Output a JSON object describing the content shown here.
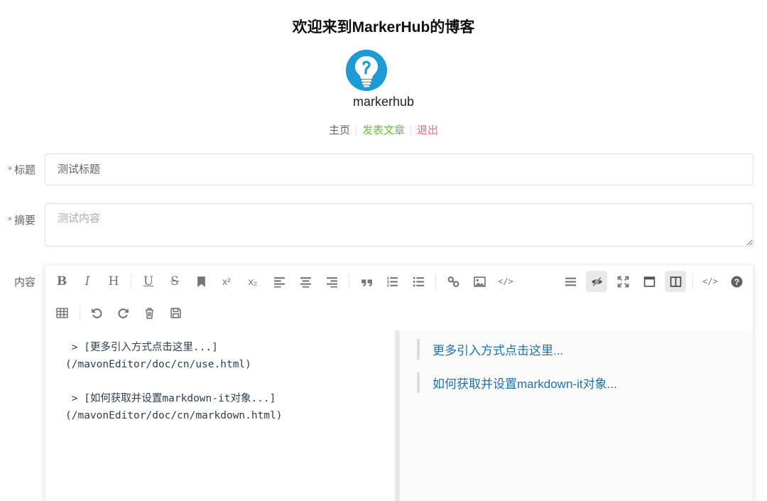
{
  "site": {
    "title": "欢迎来到MarkerHub的博客",
    "username": "markerhub"
  },
  "nav": {
    "home": "主页",
    "post": "发表文章",
    "logout": "退出"
  },
  "form": {
    "title_label": "标题",
    "title_value": "测试标题",
    "summary_label": "摘要",
    "summary_placeholder": "测试内容",
    "content_label": "内容",
    "required_mark": "*"
  },
  "toolbar": {
    "row1_left": [
      "bold",
      "italic",
      "header",
      "underline",
      "strikethrough",
      "mark",
      "superscript",
      "subscript",
      "align-left",
      "align-center",
      "align-right",
      "quote",
      "ordered-list",
      "unordered-list",
      "link",
      "image",
      "code"
    ],
    "row1_right": [
      "navigation",
      "preview-toggle",
      "fullscreen",
      "read-mode",
      "subfield",
      "html-code",
      "help"
    ],
    "row2": [
      "table",
      "undo",
      "redo",
      "trash",
      "save"
    ],
    "bold_glyph": "B",
    "italic_glyph": "I",
    "header_glyph": "H",
    "underline_glyph": "U",
    "strike_glyph": "S",
    "sup_glyph": "x²",
    "sub_glyph": "x₂",
    "code_glyph": "</>",
    "help_glyph": "?"
  },
  "editor": {
    "content": " > [更多引入方式点击这里...]\n(/mavonEditor/doc/cn/use.html)\n\n > [如何获取并设置markdown-it对象...]\n(/mavonEditor/doc/cn/markdown.html)"
  },
  "preview": {
    "links": [
      "更多引入方式点击这里...",
      "如何获取并设置markdown-it对象..."
    ]
  },
  "colors": {
    "primary": "#1e9bd7",
    "success": "#67c23a",
    "danger": "#f56c6c",
    "link": "#1f6fb2"
  }
}
